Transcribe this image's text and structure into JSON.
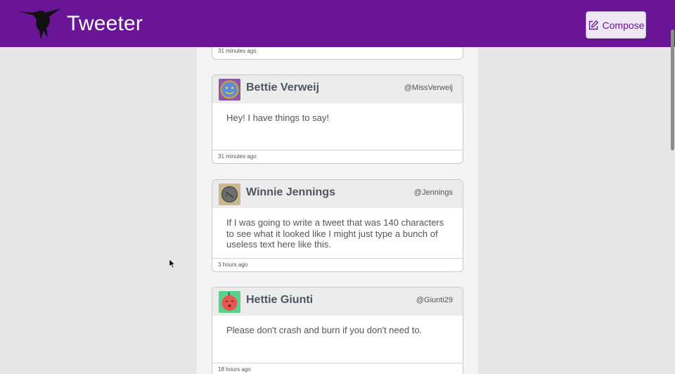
{
  "header": {
    "brand": "Tweeter",
    "compose_label": "Compose",
    "brand_color": "#6a1598"
  },
  "partial_tweet": {
    "timestamp": "31 minutes ago"
  },
  "tweets": [
    {
      "name": "Bettie Verweij",
      "handle": "@MissVerweij",
      "text": "Hey! I have things to say!",
      "timestamp": "31 minutes ago",
      "avatar": "blue-face-avatar"
    },
    {
      "name": "Winnie Jennings",
      "handle": "@Jennings",
      "text": "If I was going to write a tweet that was 140 characters to see what it looked like I might just type a bunch of useless text here like this.",
      "timestamp": "3 hours ago",
      "avatar": "grey-sphere-avatar"
    },
    {
      "name": "Hettie Giunti",
      "handle": "@Giunti29",
      "text": "Please don't crash and burn if you don't need to.",
      "timestamp": "18 hours ago",
      "avatar": "baby-face-avatar"
    }
  ]
}
